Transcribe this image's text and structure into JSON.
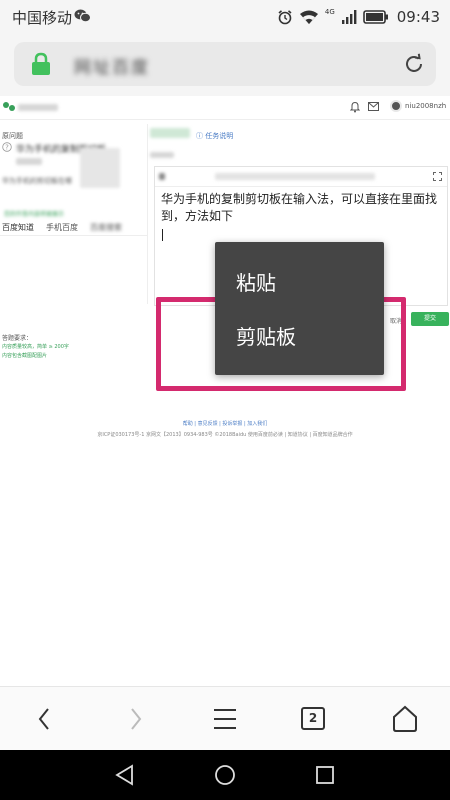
{
  "status_bar": {
    "carrier": "中国移动",
    "network": "4G",
    "time": "09:43",
    "icons": [
      "wechat-icon",
      "alarm-icon",
      "wifi-icon",
      "signal-icon",
      "battery-icon"
    ]
  },
  "address_bar": {
    "url_text": "网址百度",
    "lock_color": "#42c15d"
  },
  "webpage": {
    "username": "niu2008nzh",
    "task_link": "任务说明",
    "original_question_label": "原问题",
    "question_title": "华为手机的复制剪切板",
    "question_desc": "华为手机的剪切板在哪",
    "answer_hint": "您的作答内容将被展示",
    "tabs": [
      "百度知道",
      "手机百度",
      "百度搜索"
    ],
    "answer_text": "华为手机的复制剪切板在输入法，可以直接在里面找到，方法如下",
    "requirements_title": "答题要求：",
    "requirements": [
      "内容质量较高，简单 ≥ 200字",
      "内容包含截图配图片"
    ],
    "cancel_label": "取消",
    "submit_label": "提交",
    "footer_links": "帮助 | 意见反馈 | 投诉举报 | 加入我们",
    "footer_icp": "京ICP证030173号-1  京网文【2013】0934-983号  ©2018Baidu  使用百度前必读 | 知道协议 | 百度知道品牌合作"
  },
  "context_menu": {
    "items": [
      "粘贴",
      "剪贴板"
    ],
    "background": "#454545"
  },
  "highlight_color": "#d42a6e",
  "browser_toolbar": {
    "tab_count": "2"
  }
}
